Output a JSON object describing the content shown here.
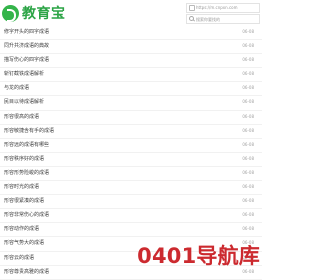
{
  "header": {
    "logo_text": "教育宝",
    "url_text": "https://m.cnpxn.com",
    "search_placeholder": "搜索你要找的"
  },
  "articles": [
    {
      "title": "修字开头的四字成语",
      "date": "06-08"
    },
    {
      "title": "同升共济成语的典故",
      "date": "06-08"
    },
    {
      "title": "描写伤心的四字成语",
      "date": "06-08"
    },
    {
      "title": "斩钉截铁成语解析",
      "date": "06-08"
    },
    {
      "title": "与龙的成语",
      "date": "06-08"
    },
    {
      "title": "民目以待成语解析",
      "date": "06-08"
    },
    {
      "title": "形容很高的成语",
      "date": "06-08"
    },
    {
      "title": "形容敏捷含有手的成语",
      "date": "06-08"
    },
    {
      "title": "形容远的成语有哪些",
      "date": "06-08"
    },
    {
      "title": "形容秩序好的成语",
      "date": "06-08"
    },
    {
      "title": "形容形势险峻的成语",
      "date": "06-08"
    },
    {
      "title": "形容时光的成语",
      "date": "06-08"
    },
    {
      "title": "形容很紧凑的成语",
      "date": "06-08"
    },
    {
      "title": "形容非常伤心的成语",
      "date": "06-08"
    },
    {
      "title": "形容动作的成语",
      "date": "06-08"
    },
    {
      "title": "形容气势大的成语",
      "date": "06-08"
    },
    {
      "title": "形容云的成语",
      "date": "06-08"
    },
    {
      "title": "形容尊贵高雅的成语",
      "date": "06-08"
    }
  ],
  "watermark": "0401导航库",
  "colors": {
    "brand": "#2ca446",
    "watermark": "#cc2a2f"
  }
}
